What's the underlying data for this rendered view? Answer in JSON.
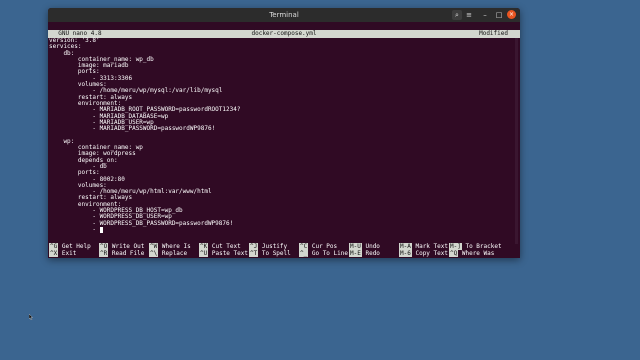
{
  "window": {
    "title": "Terminal"
  },
  "titlebar_buttons": {
    "search": "⌕",
    "menu": "≡",
    "minimize": "–",
    "maximize": "□",
    "close": "×"
  },
  "nano": {
    "version": "  GNU nano 4.8",
    "filename": "docker-compose.yml",
    "status": "Modified"
  },
  "code_lines": [
    "version: '3.8'",
    "services:",
    "    db:",
    "        container_name: wp_db",
    "        image: mariadb",
    "        ports:",
    "            - 3313:3306",
    "        volumes:",
    "            - /home/meru/wp/mysql:/var/lib/mysql",
    "        restart: always",
    "        environment:",
    "            - MARIADB_ROOT_PASSWORD=passwordROOT1234?",
    "            - MARIADB_DATABASE=wp",
    "            - MARIADB_USER=wp",
    "            - MARIADB_PASSWORD=passwordWP9876!",
    "",
    "    wp:",
    "        container_name: wp",
    "        image: wordpress",
    "        depends_on:",
    "            - db",
    "        ports:",
    "            - 8002:80",
    "        volumes:",
    "            - /home/meru/wp/html:var/www/html",
    "        restart: always",
    "        environment:",
    "            - WORDPRESS_DB_HOST=wp_db",
    "            - WORDPRESS_DB_USER=wp",
    "            - WORDPRESS_DB_PASSWORD=passwordWP9876!",
    "            - "
  ],
  "shortcuts_row1": [
    {
      "key": "^G",
      "label": "Get Help"
    },
    {
      "key": "^O",
      "label": "Write Out"
    },
    {
      "key": "^W",
      "label": "Where Is"
    },
    {
      "key": "^K",
      "label": "Cut Text"
    },
    {
      "key": "^J",
      "label": "Justify"
    },
    {
      "key": "^C",
      "label": "Cur Pos"
    },
    {
      "key": "M-U",
      "label": "Undo"
    },
    {
      "key": "M-A",
      "label": "Mark Text"
    },
    {
      "key": "M-]",
      "label": "To Bracket"
    }
  ],
  "shortcuts_row2": [
    {
      "key": "^X",
      "label": "Exit"
    },
    {
      "key": "^R",
      "label": "Read File"
    },
    {
      "key": "^\\",
      "label": "Replace"
    },
    {
      "key": "^U",
      "label": "Paste Text"
    },
    {
      "key": "^T",
      "label": "To Spell"
    },
    {
      "key": "^_",
      "label": "Go To Line"
    },
    {
      "key": "M-E",
      "label": "Redo"
    },
    {
      "key": "M-6",
      "label": "Copy Text"
    },
    {
      "key": "^Q",
      "label": "Where Was"
    }
  ],
  "colors": {
    "desktop": "#3b6590",
    "terminal_bg": "#300a24",
    "titlebar": "#2c2c2c",
    "nano_bar": "#d3d7cf",
    "close_button": "#e95420"
  }
}
